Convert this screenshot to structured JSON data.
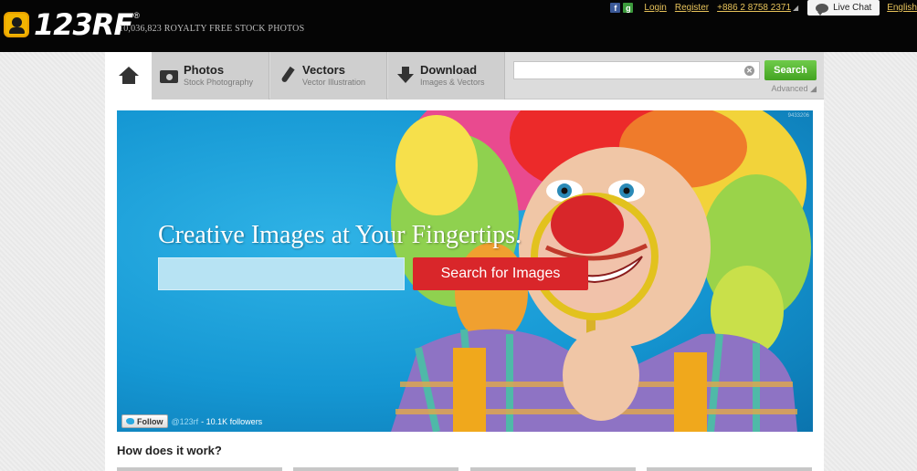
{
  "header": {
    "logo_text": "123RF",
    "logo_reg": "®",
    "tagline": "10,036,823  ROYALTY FREE STOCK PHOTOS",
    "links": {
      "login": "Login",
      "register": "Register",
      "phone": "+886 2 8758 2371",
      "live_chat": "Live Chat",
      "language": "English"
    },
    "social": {
      "facebook": "f",
      "google": "g"
    }
  },
  "nav": {
    "tabs": [
      {
        "title": "Photos",
        "subtitle": "Stock Photography",
        "icon": "camera-icon"
      },
      {
        "title": "Vectors",
        "subtitle": "Vector Illustration",
        "icon": "pen-icon"
      },
      {
        "title": "Download",
        "subtitle": "Images & Vectors",
        "icon": "download-icon"
      }
    ],
    "search_placeholder": "",
    "search_button": "Search",
    "advanced": "Advanced"
  },
  "hero": {
    "heading": "Creative Images at Your Fingertips.",
    "input_placeholder": "",
    "button": "Search for Images",
    "credit": "9433206"
  },
  "twitter": {
    "follow": "Follow",
    "handle": "@123rf",
    "followers": "- 10.1K followers"
  },
  "how": {
    "title": "How does it work?"
  },
  "colors": {
    "top_bar": "#050505",
    "link": "#e6c25a",
    "search_green": "#4caf2a",
    "hero_button": "#d9262a",
    "hero_bg": "#1597d3"
  }
}
